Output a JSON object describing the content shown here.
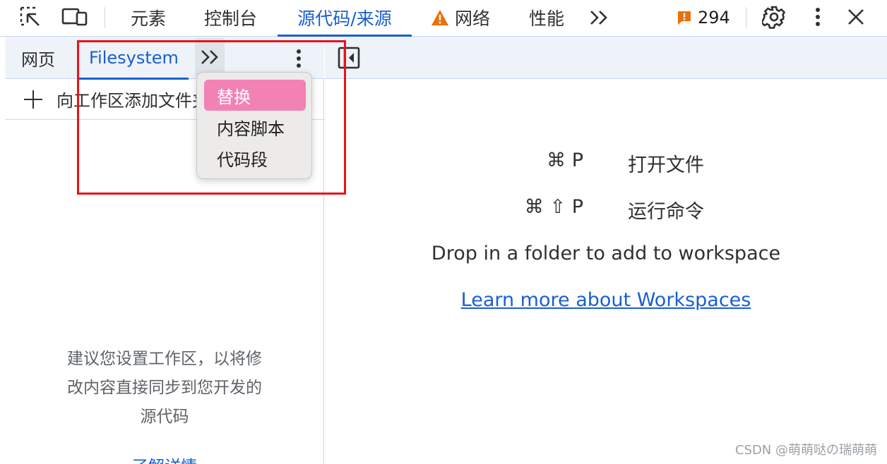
{
  "toolbar": {
    "inspect_icon": "select-element-icon",
    "device_icon": "device-toolbar-icon",
    "tabs": [
      "元素",
      "控制台",
      "源代码/来源",
      "网络",
      "性能"
    ],
    "network_warning_icon": "warning-triangle-icon",
    "more_tabs_label": ">>",
    "issues_count": "294",
    "settings_icon": "gear-icon",
    "menu_icon": "vertical-dots-icon",
    "close_icon": "close-icon",
    "accent_color": "#1a5fd0",
    "warning_color": "#e8710a"
  },
  "navigator": {
    "tabs": [
      "网页",
      "Filesystem"
    ],
    "more_tabs_label": ">>",
    "add_folder_label": "向工作区添加文件夹",
    "hint_lines": [
      "建议您设置工作区，以将修",
      "改内容直接同步到您开发的",
      "源代码"
    ],
    "learn_more": "了解详情"
  },
  "dropdown": {
    "items": [
      "替换",
      "内容脚本",
      "代码段"
    ],
    "selected_index": 0,
    "highlight_color": "#f282b4"
  },
  "editor": {
    "shortcuts": [
      {
        "keys": "⌘ P",
        "label": "打开文件"
      },
      {
        "keys": "⌘ ⇧ P",
        "label": "运行命令"
      }
    ],
    "drop_text": "Drop in a folder to add to workspace",
    "learn_more_link": "Learn more about Workspaces"
  },
  "annotation": {
    "box_color": "#e8121a"
  },
  "watermark": "CSDN @萌萌哒の瑞萌萌"
}
